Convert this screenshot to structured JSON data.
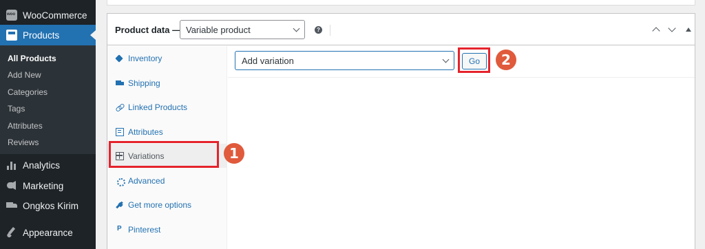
{
  "sidebar": {
    "top_items": [
      {
        "label": "WooCommerce",
        "icon": "woocommerce-icon"
      },
      {
        "label": "Products",
        "icon": "products-icon",
        "active": true
      }
    ],
    "submenu": [
      {
        "label": "All Products",
        "current": true
      },
      {
        "label": "Add New"
      },
      {
        "label": "Categories"
      },
      {
        "label": "Tags"
      },
      {
        "label": "Attributes"
      },
      {
        "label": "Reviews"
      }
    ],
    "bottom_items": [
      {
        "label": "Analytics",
        "icon": "analytics-icon"
      },
      {
        "label": "Marketing",
        "icon": "megaphone-icon"
      },
      {
        "label": "Ongkos Kirim",
        "icon": "truck-icon"
      },
      {
        "label": "Appearance",
        "icon": "brush-icon"
      }
    ]
  },
  "product_data": {
    "title": "Product data —",
    "type_select": "Variable product",
    "help": "?",
    "tabs": [
      {
        "label": "Inventory",
        "icon": "tag-icon"
      },
      {
        "label": "Shipping",
        "icon": "truck-icon"
      },
      {
        "label": "Linked Products",
        "icon": "link-icon"
      },
      {
        "label": "Attributes",
        "icon": "list-icon"
      },
      {
        "label": "Variations",
        "icon": "grid-icon",
        "active": true
      },
      {
        "label": "Advanced",
        "icon": "gear-icon"
      },
      {
        "label": "Get more options",
        "icon": "plug-icon"
      },
      {
        "label": "Pinterest",
        "icon": "pinterest-icon"
      }
    ]
  },
  "variations": {
    "action_select": "Add variation",
    "go_label": "Go"
  },
  "annotations": {
    "step1": "1",
    "step2": "2",
    "highlight_color": "#e5232c",
    "badge_color": "#e05a3c"
  },
  "colors": {
    "admin_bar": "#1d2327",
    "accent": "#2271b1"
  }
}
